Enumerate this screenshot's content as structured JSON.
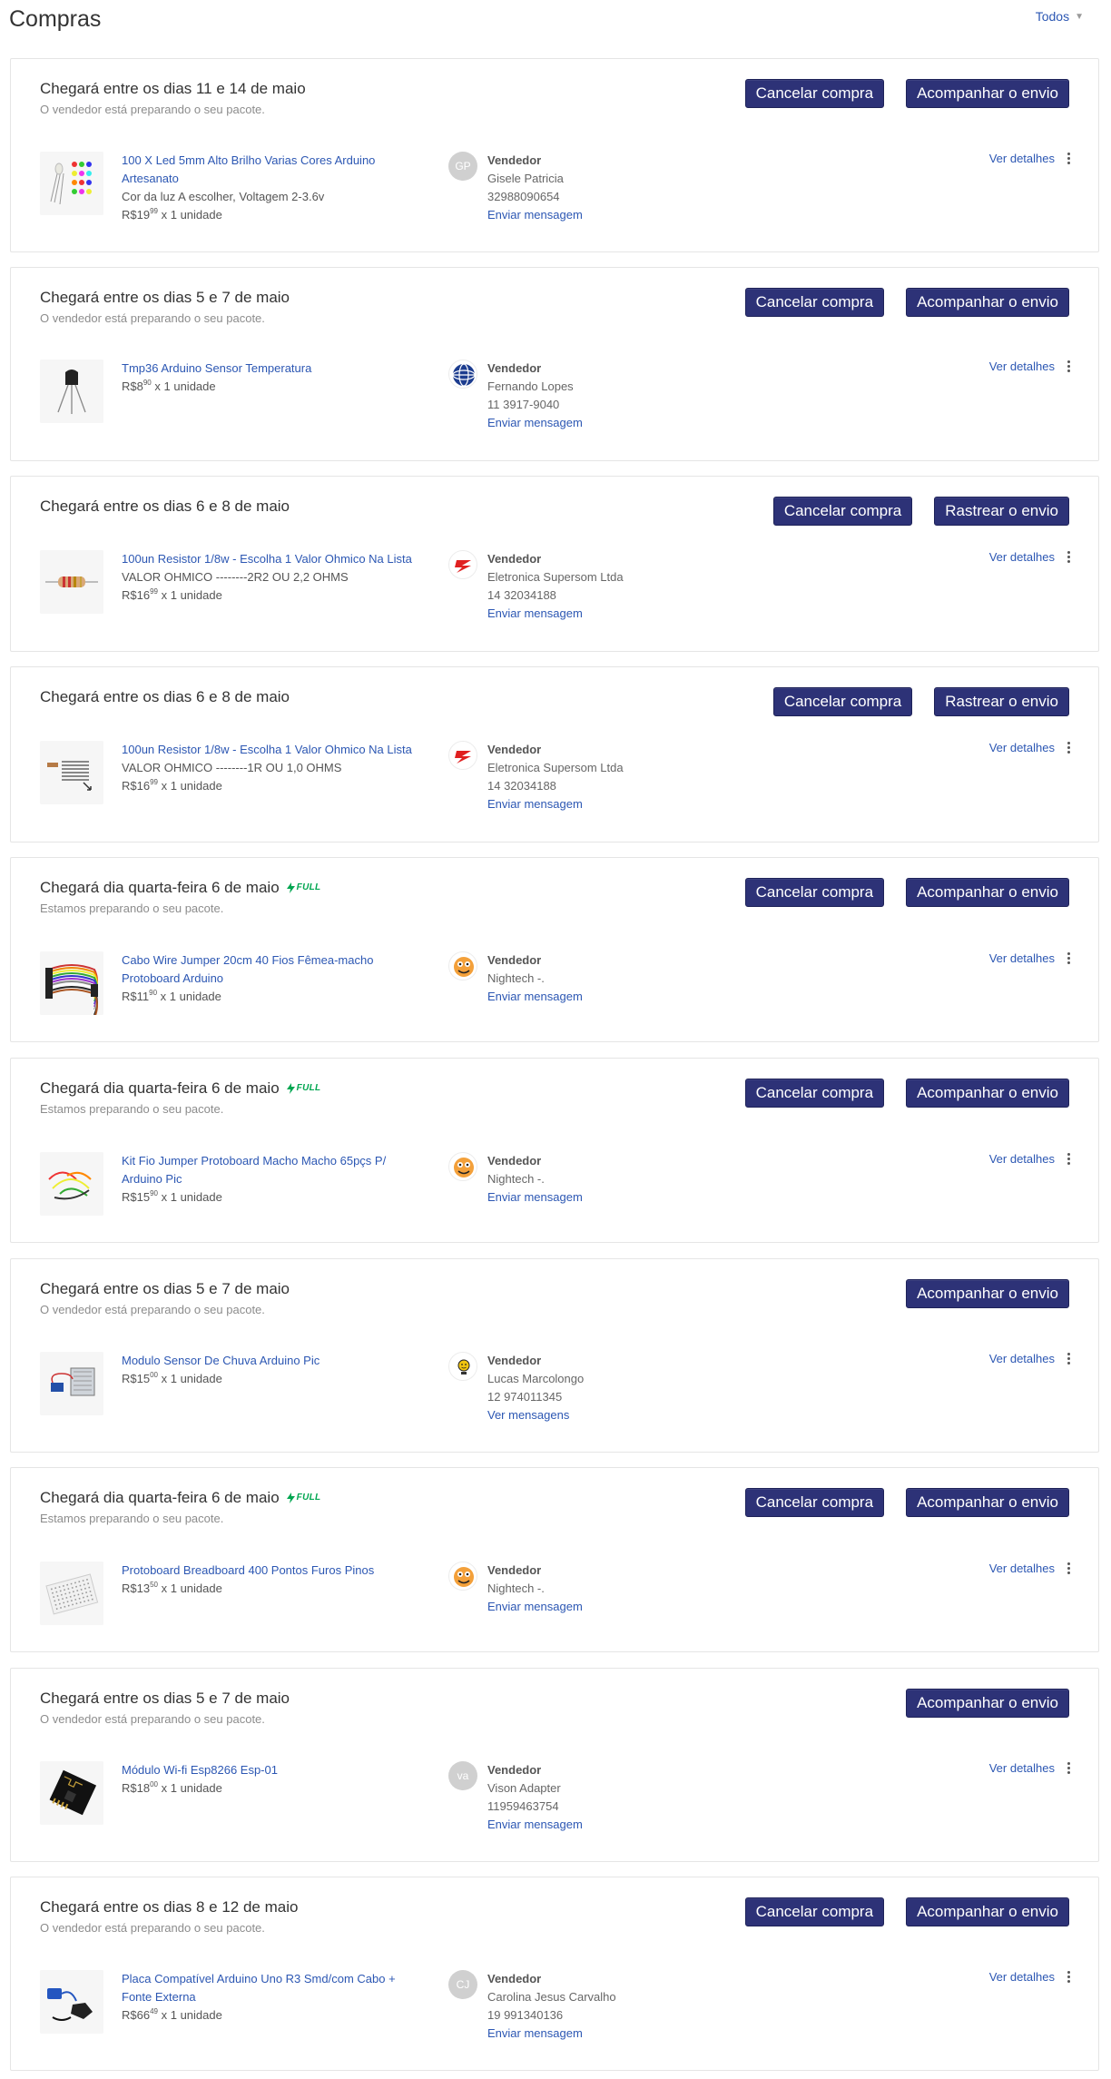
{
  "page": {
    "title": "Compras",
    "filter_label": "Todos"
  },
  "colors": {
    "primary_button": "#2d3277",
    "link": "#2c57b3",
    "full_badge": "#00a650"
  },
  "orders": [
    {
      "title": "Chegará entre os dias 11 e 14 de maio",
      "full": false,
      "subtitle": "O vendedor está preparando o seu pacote.",
      "buttons": [
        "Cancelar compra",
        "Acompanhar o envio"
      ],
      "thumb": "led-icon",
      "item": {
        "title": "100 X Led 5mm Alto Brilho Varias Cores Arduino Artesanato",
        "variant": "Cor da luz A escolher, Voltagem 2-3.6v",
        "currency": "R$",
        "price_int": "19",
        "price_cents": "99",
        "qty": "x 1 unidade"
      },
      "seller": {
        "label": "Vendedor",
        "name": "Gisele Patricia",
        "phone": "32988090654",
        "message": "Enviar mensagem",
        "avatar_text": "GP",
        "avatar": "initials"
      },
      "details": "Ver detalhes"
    },
    {
      "title": "Chegará entre os dias 5 e 7 de maio",
      "full": false,
      "subtitle": "O vendedor está preparando o seu pacote.",
      "buttons": [
        "Cancelar compra",
        "Acompanhar o envio"
      ],
      "thumb": "sensor-icon",
      "item": {
        "title": "Tmp36 Arduino Sensor Temperatura",
        "variant": "",
        "currency": "R$",
        "price_int": "8",
        "price_cents": "90",
        "qty": "x 1 unidade"
      },
      "seller": {
        "label": "Vendedor",
        "name": "Fernando Lopes",
        "phone": "11 3917-9040",
        "message": "Enviar mensagem",
        "avatar_text": "",
        "avatar": "globe-logo"
      },
      "details": "Ver detalhes"
    },
    {
      "title": "Chegará entre os dias 6 e 8 de maio",
      "full": false,
      "subtitle": "",
      "buttons": [
        "Cancelar compra",
        "Rastrear o envio"
      ],
      "thumb": "resistor-icon",
      "item": {
        "title": "100un Resistor 1/8w - Escolha 1 Valor Ohmico Na Lista",
        "variant": "VALOR OHMICO --------2R2 OU 2,2 OHMS",
        "currency": "R$",
        "price_int": "16",
        "price_cents": "99",
        "qty": "x 1 unidade"
      },
      "seller": {
        "label": "Vendedor",
        "name": "Eletronica Supersom Ltda",
        "phone": "14 32034188",
        "message": "Enviar mensagem",
        "avatar_text": "",
        "avatar": "supersom-logo"
      },
      "details": "Ver detalhes"
    },
    {
      "title": "Chegará entre os dias 6 e 8 de maio",
      "full": false,
      "subtitle": "",
      "buttons": [
        "Cancelar compra",
        "Rastrear o envio"
      ],
      "thumb": "resistor-chart-icon",
      "item": {
        "title": "100un Resistor 1/8w - Escolha 1 Valor Ohmico Na Lista",
        "variant": "VALOR OHMICO --------1R OU 1,0 OHMS",
        "currency": "R$",
        "price_int": "16",
        "price_cents": "99",
        "qty": "x 1 unidade"
      },
      "seller": {
        "label": "Vendedor",
        "name": "Eletronica Supersom Ltda",
        "phone": "14 32034188",
        "message": "Enviar mensagem",
        "avatar_text": "",
        "avatar": "supersom-logo"
      },
      "details": "Ver detalhes"
    },
    {
      "title": "Chegará dia quarta-feira 6 de maio",
      "full": true,
      "full_label": "FULL",
      "subtitle": "Estamos preparando o seu pacote.",
      "buttons": [
        "Cancelar compra",
        "Acompanhar o envio"
      ],
      "thumb": "jumper-cable-icon",
      "item": {
        "title": "Cabo Wire Jumper 20cm 40 Fios Fêmea-macho Protoboard Arduino",
        "variant": "",
        "currency": "R$",
        "price_int": "11",
        "price_cents": "90",
        "qty": "x 1 unidade"
      },
      "seller": {
        "label": "Vendedor",
        "name": "Nightech -.",
        "phone": "",
        "message": "Enviar mensagem",
        "avatar_text": "",
        "avatar": "nightech-logo"
      },
      "details": "Ver detalhes"
    },
    {
      "title": "Chegará dia quarta-feira 6 de maio",
      "full": true,
      "full_label": "FULL",
      "subtitle": "Estamos preparando o seu pacote.",
      "buttons": [
        "Cancelar compra",
        "Acompanhar o envio"
      ],
      "thumb": "jumper-kit-icon",
      "item": {
        "title": "Kit Fio Jumper Protoboard Macho Macho 65pçs P/ Arduino Pic",
        "variant": "",
        "currency": "R$",
        "price_int": "15",
        "price_cents": "90",
        "qty": "x 1 unidade"
      },
      "seller": {
        "label": "Vendedor",
        "name": "Nightech -.",
        "phone": "",
        "message": "Enviar mensagem",
        "avatar_text": "",
        "avatar": "nightech-logo"
      },
      "details": "Ver detalhes"
    },
    {
      "title": "Chegará entre os dias 5 e 7 de maio",
      "full": false,
      "subtitle": "O vendedor está preparando o seu pacote.",
      "buttons": [
        "Acompanhar o envio"
      ],
      "thumb": "rain-sensor-icon",
      "item": {
        "title": "Modulo Sensor De Chuva Arduino Pic",
        "variant": "",
        "currency": "R$",
        "price_int": "15",
        "price_cents": "00",
        "qty": "x 1 unidade"
      },
      "seller": {
        "label": "Vendedor",
        "name": "Lucas Marcolongo",
        "phone": "12 974011345",
        "message": "Ver mensagens",
        "avatar_text": "",
        "avatar": "smiley-logo"
      },
      "details": "Ver detalhes"
    },
    {
      "title": "Chegará dia quarta-feira 6 de maio",
      "full": true,
      "full_label": "FULL",
      "subtitle": "Estamos preparando o seu pacote.",
      "buttons": [
        "Cancelar compra",
        "Acompanhar o envio"
      ],
      "thumb": "breadboard-icon",
      "item": {
        "title": "Protoboard Breadboard 400 Pontos Furos Pinos",
        "variant": "",
        "currency": "R$",
        "price_int": "13",
        "price_cents": "50",
        "qty": "x 1 unidade"
      },
      "seller": {
        "label": "Vendedor",
        "name": "Nightech -.",
        "phone": "",
        "message": "Enviar mensagem",
        "avatar_text": "",
        "avatar": "nightech-logo"
      },
      "details": "Ver detalhes"
    },
    {
      "title": "Chegará entre os dias 5 e 7 de maio",
      "full": false,
      "subtitle": "O vendedor está preparando o seu pacote.",
      "buttons": [
        "Acompanhar o envio"
      ],
      "thumb": "wifi-module-icon",
      "item": {
        "title": "Módulo Wi-fi Esp8266 Esp-01",
        "variant": "",
        "currency": "R$",
        "price_int": "18",
        "price_cents": "00",
        "qty": "x 1 unidade"
      },
      "seller": {
        "label": "Vendedor",
        "name": "Vison Adapter",
        "phone": "11959463754",
        "message": "Enviar mensagem",
        "avatar_text": "va",
        "avatar": "initials"
      },
      "details": "Ver detalhes"
    },
    {
      "title": "Chegará entre os dias 8 e 12 de maio",
      "full": false,
      "subtitle": "O vendedor está preparando o seu pacote.",
      "buttons": [
        "Cancelar compra",
        "Acompanhar o envio"
      ],
      "thumb": "arduino-board-icon",
      "item": {
        "title": "Placa Compatível Arduino Uno R3 Smd/com Cabo + Fonte Externa",
        "variant": "",
        "currency": "R$",
        "price_int": "66",
        "price_cents": "49",
        "qty": "x 1 unidade"
      },
      "seller": {
        "label": "Vendedor",
        "name": "Carolina Jesus Carvalho",
        "phone": "19 991340136",
        "message": "Enviar mensagem",
        "avatar_text": "CJ",
        "avatar": "initials"
      },
      "details": "Ver detalhes"
    }
  ]
}
